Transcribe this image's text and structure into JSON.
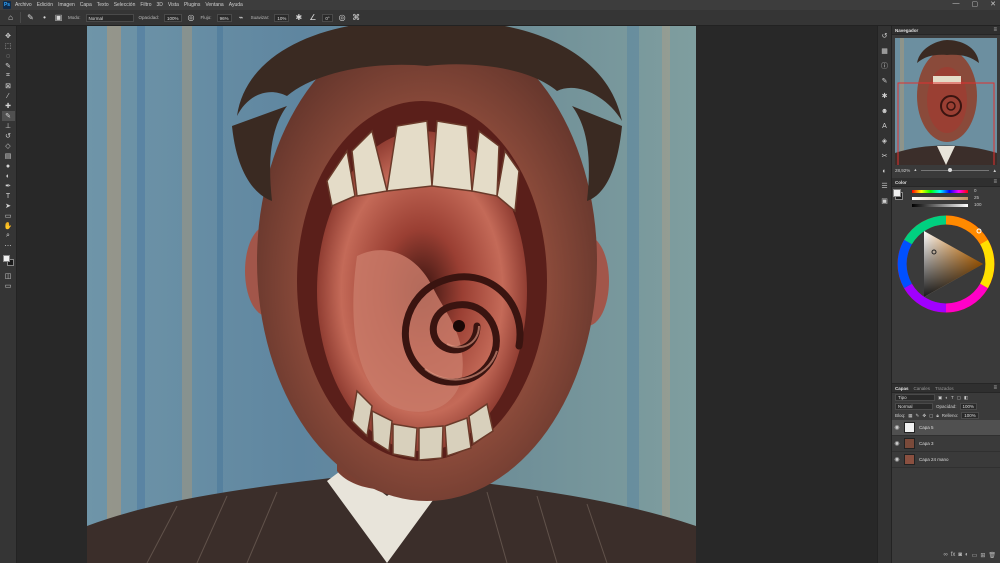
{
  "menubar": {
    "logo": "Ps",
    "items": [
      "Archivo",
      "Edición",
      "Imagen",
      "Capa",
      "Texto",
      "Selección",
      "Filtro",
      "3D",
      "Vista",
      "Plugins",
      "Ventana",
      "Ayuda"
    ],
    "window_controls": [
      "—",
      "▢",
      "✕"
    ]
  },
  "options": {
    "mode_label": "Modo:",
    "mode_value": "Normal",
    "opacity_label": "Opacidad:",
    "opacity_value": "100%",
    "flow_label": "Flujo:",
    "flow_value": "96%",
    "smoothing_label": "Suavizar:",
    "smoothing_value": "10%",
    "angle_value": "0°"
  },
  "tools": [
    "move",
    "marquee",
    "lasso",
    "quick-select",
    "crop",
    "frame",
    "eyedropper",
    "spot-heal",
    "brush",
    "clone-stamp",
    "history-brush",
    "eraser",
    "gradient",
    "blur",
    "dodge",
    "pen",
    "type",
    "path-select",
    "rectangle",
    "hand",
    "zoom",
    "more"
  ],
  "navigator": {
    "title": "Navegador",
    "zoom": "28,92%"
  },
  "color_panel": {
    "title": "Color",
    "slider_values": [
      "0",
      "25",
      "100"
    ],
    "colors": {
      "foreground": "#f0f0f0",
      "background": "#1a1a1a",
      "picked": "#e6e6e6"
    }
  },
  "layers": {
    "tabs": [
      "Capas",
      "Canales",
      "Trazados"
    ],
    "filter_label": "Tipo",
    "blend_mode": "Normal",
    "opacity_label": "Opacidad:",
    "opacity_value": "100%",
    "lock_label": "Bloq:",
    "fill_label": "Relleno:",
    "fill_value": "100%",
    "items": [
      {
        "name": "Capa 5"
      },
      {
        "name": "Capa 3"
      },
      {
        "name": "Capa 24 mano"
      }
    ]
  }
}
